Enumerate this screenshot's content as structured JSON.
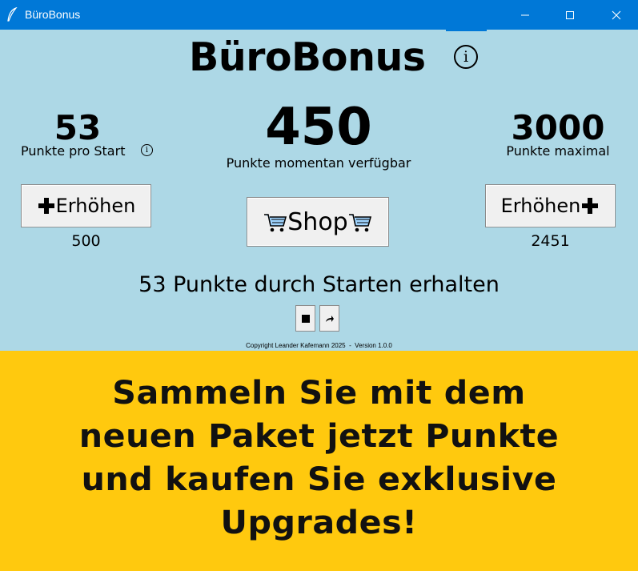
{
  "window": {
    "title": "BüroBonus",
    "icon": "feather-icon"
  },
  "header": {
    "app_title": "BüroBonus",
    "info_symbol": "i"
  },
  "stats": {
    "points_per_start": "53",
    "points_per_start_label": "Punkte pro Start",
    "info_symbol": "i",
    "points_available": "450",
    "points_available_label": "Punkte momentan verfügbar",
    "points_max": "3000",
    "points_max_label": "Punkte maximal"
  },
  "buttons": {
    "increase_left_label": "Erhöhen",
    "increase_left_cost": "500",
    "shop_label": "Shop",
    "increase_right_label": "Erhöhen",
    "increase_right_cost": "2451"
  },
  "message": "53 Punkte durch Starten erhalten",
  "controls": {
    "stop_icon": "stop-icon",
    "next_icon": "forward-arrow-icon"
  },
  "footer": {
    "copyright": "Copyright Leander Kafemann 2025  -  Version 1.0.0"
  },
  "banner": {
    "text_line1": "Sammeln Sie mit dem",
    "text_line2": "neuen Paket jetzt Punkte",
    "text_line3": "und kaufen Sie exklusive",
    "text_line4": "Upgrades!",
    "background": "#FFC90E"
  },
  "colors": {
    "titlebar": "#0078D7",
    "background": "#ADD8E6",
    "button_face": "#F0F0F0"
  }
}
